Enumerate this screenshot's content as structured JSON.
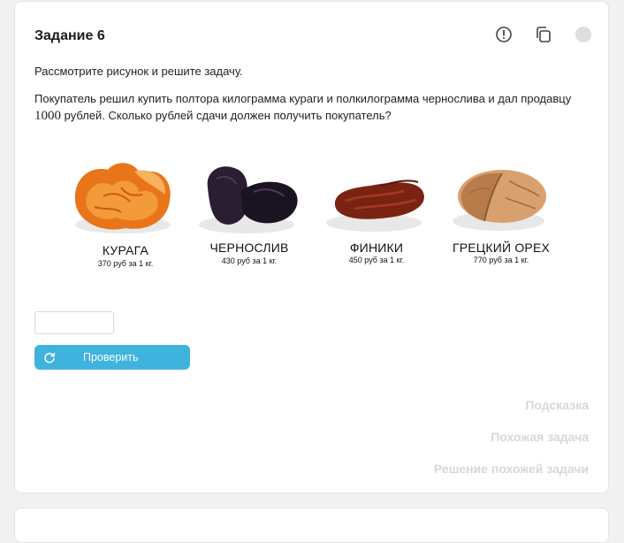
{
  "task": {
    "title": "Задание 6",
    "instruction": "Рассмотрите рисунок и решите задачу.",
    "problem_before": "Покупатель решил купить полтора килограмма кураги и полкилограмма чернослива и дал продавцу",
    "problem_number": "1000",
    "problem_after": "рублей. Сколько рублей сдачи должен получить покупатель?"
  },
  "header_icons": [
    "alert-circle-icon",
    "copy-icon",
    "status-dot"
  ],
  "products": [
    {
      "name": "КУРАГА",
      "price": "370 руб за 1 кг."
    },
    {
      "name": "ЧЕРНОСЛИВ",
      "price": "430 руб за 1 кг."
    },
    {
      "name": "ФИНИКИ",
      "price": "450 руб за 1 кг."
    },
    {
      "name": "ГРЕЦКИЙ ОРЕХ",
      "price": "770 руб за 1 кг."
    }
  ],
  "answer": {
    "value": "",
    "placeholder": ""
  },
  "check_button": {
    "label": "Проверить",
    "icon": "refresh-icon"
  },
  "links": {
    "hint": "Подсказка",
    "similar": "Похожая задача",
    "solution": "Решение похожей задачи"
  },
  "colors": {
    "accent": "#3fb3de",
    "link_muted": "#d7d7d7"
  }
}
